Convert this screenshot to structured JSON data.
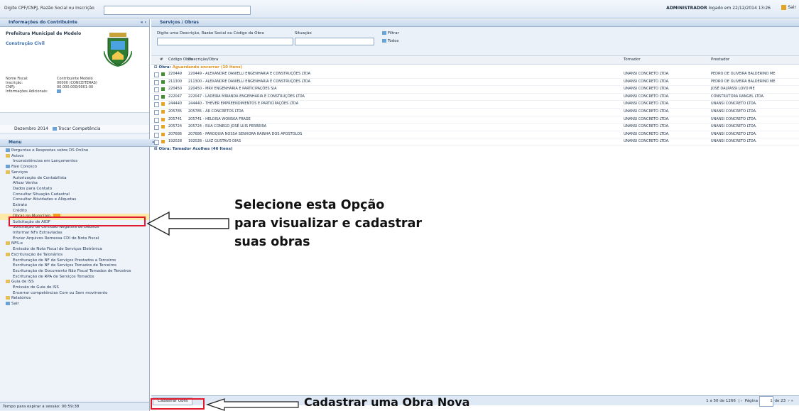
{
  "topbar": {
    "search_label": "Digite CPF/CNPJ, Razão Social ou Inscrição",
    "user_name": "ADMINISTRADOR",
    "login_info": "logado em 22/12/2014 13:26",
    "logout": "Sair"
  },
  "left_panel": {
    "title": "Informações do Contribuinte",
    "org_name": "Prefeitura Municipal de Modelo",
    "category": "Construção Civil",
    "info": [
      {
        "k": "Nome Fiscal:",
        "v": "Contribuinte Modelo"
      },
      {
        "k": "Inscrição:",
        "v": "00000 (CONCEITERAS)"
      },
      {
        "k": "CNPJ:",
        "v": "00.000.000/0001-00"
      },
      {
        "k": "Informações Adicionais:",
        "v": ""
      }
    ],
    "period": "Dezembro 2014",
    "period_button": "Trocar Competência",
    "menu_title": "Menu",
    "tree": [
      {
        "text": "Perguntas e Respostas sobre DS Online",
        "level": 1,
        "icon": "help"
      },
      {
        "text": "Avisos",
        "level": 1,
        "icon": "folder"
      },
      {
        "text": "Inconsistências em Lançamentos",
        "level": 2,
        "icon": "page"
      },
      {
        "text": "Fale Conosco",
        "level": 1,
        "icon": "mail"
      },
      {
        "text": "Serviços",
        "level": 1,
        "icon": "folder"
      },
      {
        "text": "Autorização de Contabilista",
        "level": 2,
        "icon": "none"
      },
      {
        "text": "Afixar Venha",
        "level": 2,
        "icon": "none"
      },
      {
        "text": "Dados para Contato",
        "level": 2,
        "icon": "none"
      },
      {
        "text": "Consultar Situação Cadastral",
        "level": 2,
        "icon": "none"
      },
      {
        "text": "Consultar Atividades e Alíquotas",
        "level": 2,
        "icon": "none"
      },
      {
        "text": "Extrato",
        "level": 2,
        "icon": "none"
      },
      {
        "text": "Crédito",
        "level": 2,
        "icon": "none"
      },
      {
        "text": "Obras no Município",
        "level": 2,
        "icon": "none",
        "highlight": true
      },
      {
        "text": "Solicitação de AIDF",
        "level": 2,
        "icon": "none"
      },
      {
        "text": "Solicitação de Certidão Negativa de Débitos",
        "level": 2,
        "icon": "none"
      },
      {
        "text": "Informar NFs Extraviadas",
        "level": 2,
        "icon": "none"
      },
      {
        "text": "Enviar Arquivos Remessa CDI de Nota Fiscal",
        "level": 2,
        "icon": "none"
      },
      {
        "text": "NFS-e",
        "level": 1,
        "icon": "folder"
      },
      {
        "text": "Emissão de Nota Fiscal de Serviços Eletrônica",
        "level": 2,
        "icon": "none"
      },
      {
        "text": "Escrituração de Talonários",
        "level": 1,
        "icon": "folder"
      },
      {
        "text": "Escrituração de NF de Serviços Prestados a Terceiros",
        "level": 2,
        "icon": "none"
      },
      {
        "text": "Escrituração de NF de Serviços Tomados de Terceiros",
        "level": 2,
        "icon": "none"
      },
      {
        "text": "Escrituração de Documento Não Fiscal Tomados de Terceiros",
        "level": 2,
        "icon": "none"
      },
      {
        "text": "Escrituração de RPA de Serviços Tomados",
        "level": 2,
        "icon": "none"
      },
      {
        "text": "Guia de ISS",
        "level": 1,
        "icon": "folder"
      },
      {
        "text": "Emissão de Guia de ISS",
        "level": 2,
        "icon": "none"
      },
      {
        "text": "Encerrar competências Com ou Sem movimento",
        "level": 2,
        "icon": "none"
      },
      {
        "text": "Relatórios",
        "level": 1,
        "icon": "folder"
      },
      {
        "text": "Sair",
        "level": 1,
        "icon": "exit"
      }
    ],
    "footer": "Tempo para expirar a sessão: 00:59:38"
  },
  "main": {
    "title": "Serviços / Obras",
    "filter_label": "Digite uma Descrição, Razão Social ou Código da Obra",
    "situation_label": "Situação",
    "filter_button": "Filtrar",
    "all_button": "Todos",
    "columns": [
      "#",
      "Código Obra",
      "Descrição/Obra",
      "Tomador",
      "Prestador"
    ],
    "group1": {
      "label": "Obra: ",
      "status": "Aguardando encerrar (10 Itens)"
    },
    "rows": [
      {
        "code": "220449",
        "desc": "220449 - ALEXANDRE DANIELLI ENGENHARIA E CONSTRUÇÕES LTDA",
        "tomador": "UNANSI CONCRETO LTDA.",
        "prestador": "PEDRO DE OLIVEIRA BALDERINO ME",
        "ok": true
      },
      {
        "code": "211300",
        "desc": "211300 - ALEXANDRE DANIELLI ENGENHARIA E CONSTRUÇÕES LTDA",
        "tomador": "UNANSI CONCRETO LTDA.",
        "prestador": "PEDRO DE OLIVEIRA BALDERINO ME",
        "ok": true
      },
      {
        "code": "220450",
        "desc": "220450 - MRV ENGENHARIA E PARTICIPAÇÕES S/A",
        "tomador": "UNANSI CONCRETO LTDA.",
        "prestador": "JOSÉ DALPASSI LOVO ME",
        "ok": true
      },
      {
        "code": "222047",
        "desc": "222047 - LADEIRA MIRANDA ENGENHARIA E CONSTRUÇÕES LTDA",
        "tomador": "UNANSI CONCRETO LTDA.",
        "prestador": "CONSTRUTORA RANGEL LTDA.",
        "ok": true
      },
      {
        "code": "244440",
        "desc": "244440 - THEVER EMPREENDIMENTOS E PARTICIPAÇÕES LTDA",
        "tomador": "UNANSI CONCRETO LTDA.",
        "prestador": "UNANSI CONCRETO LTDA.",
        "ok": false
      },
      {
        "code": "205785",
        "desc": "205785 - AR CONCRETOS LTDA",
        "tomador": "UNANSI CONCRETO LTDA.",
        "prestador": "UNANSI CONCRETO LTDA.",
        "ok": false
      },
      {
        "code": "205741",
        "desc": "205741 - HELOISA WONSKA FRAGE",
        "tomador": "UNANSI CONCRETO LTDA.",
        "prestador": "UNANSI CONCRETO LTDA.",
        "ok": false
      },
      {
        "code": "205724",
        "desc": "205724 - RUA CONEGO JOSÉ LUIS FERREIRA",
        "tomador": "UNANSI CONCRETO LTDA.",
        "prestador": "UNANSI CONCRETO LTDA.",
        "ok": false
      },
      {
        "code": "207686",
        "desc": "207686 - PAROQUIA NOSSA SENHORA RAINHA DOS APOSTOLOS",
        "tomador": "UNANSI CONCRETO LTDA.",
        "prestador": "UNANSI CONCRETO LTDA.",
        "ok": false
      },
      {
        "code": "192028",
        "desc": "192028 - LUIZ GUSTAVO DIAS",
        "tomador": "UNANSI CONCRETO LTDA.",
        "prestador": "UNANSI CONCRETO LTDA.",
        "ok": false
      }
    ],
    "group2": {
      "label": "Obra: ",
      "status": "Tomador Acolhes (46 Itens)"
    },
    "footer": {
      "add_button": "Cadastrar Obra",
      "range": "1 a 50 de 1266",
      "page_label": "Página",
      "page_value": "1",
      "page_total": "de 23"
    }
  },
  "annotations": {
    "select_line1": "Selecione esta Opção",
    "select_line2": "para visualizar e cadastrar",
    "select_line3": "suas obras",
    "new_obra": "Cadastrar uma Obra Nova"
  },
  "colors": {
    "highlight_box": "#e01a2c",
    "ok_icon": "#3f8e2f",
    "pending_icon": "#e8a322"
  }
}
